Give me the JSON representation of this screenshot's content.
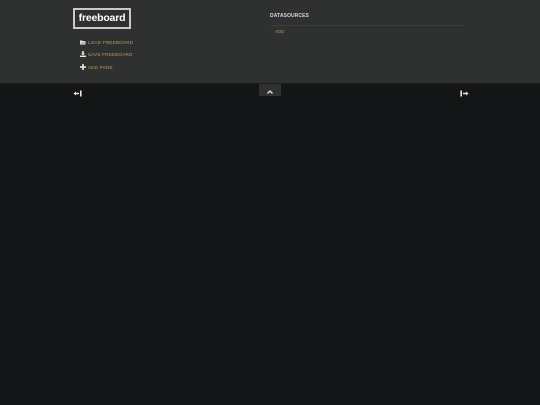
{
  "header": {
    "logo_text": "freeboard",
    "menu": [
      {
        "label": "LOAD FREEBOARD",
        "icon": "folder-open-icon"
      },
      {
        "label": "SAVE FREEBOARD",
        "icon": "download-icon"
      },
      {
        "label": "ADD PANE",
        "icon": "plus-icon"
      }
    ]
  },
  "datasources": {
    "title": "DATASOURCES",
    "add_label": "ADD"
  },
  "controls": {
    "toggle_icon": "chevron-up-icon",
    "remove_column_icon": "remove-column-icon",
    "add_column_icon": "add-column-icon"
  },
  "colors": {
    "header_bg": "#2f3030",
    "page_bg": "#141516",
    "accent": "#c69a5d",
    "text": "#d6d6d6"
  }
}
